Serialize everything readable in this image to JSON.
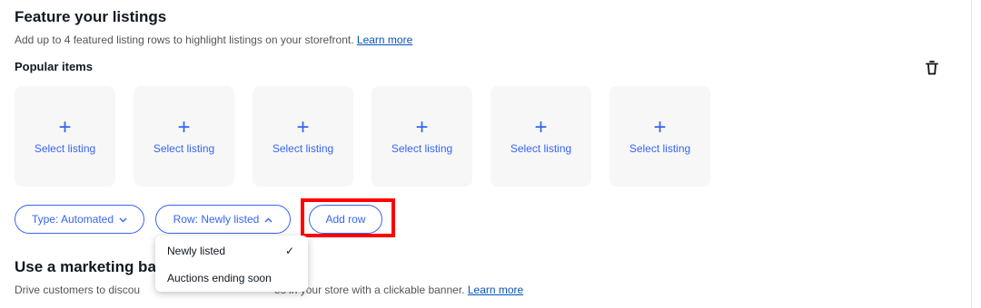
{
  "feature": {
    "title": "Feature your listings",
    "description": "Add up to 4 featured listing rows to highlight listings on your storefront.",
    "learn_more": "Learn more",
    "row_title": "Popular items",
    "tiles": [
      {
        "plus": "+",
        "label": "Select listing"
      },
      {
        "plus": "+",
        "label": "Select listing"
      },
      {
        "plus": "+",
        "label": "Select listing"
      },
      {
        "plus": "+",
        "label": "Select listing"
      },
      {
        "plus": "+",
        "label": "Select listing"
      },
      {
        "plus": "+",
        "label": "Select listing"
      }
    ],
    "type_button": "Type: Automated",
    "row_button": "Row: Newly listed",
    "add_row": "Add row"
  },
  "dropdown": {
    "options": [
      "Newly listed",
      "Auctions ending soon"
    ],
    "selected": "Newly listed",
    "check": "✓"
  },
  "banner": {
    "title": "Use a marketing ba",
    "description_before": "Drive customers to discou",
    "description_after": "es in your store with a clickable banner.",
    "learn_more": "Learn more"
  },
  "icons": {
    "trash": "trash-icon",
    "chevron_down": "chevron-down-icon",
    "chevron_up": "chevron-up-icon",
    "check": "check-icon"
  },
  "colors": {
    "accent": "#3665f3",
    "link": "#0654ba",
    "highlight": "#ff0000",
    "tile_bg": "#f7f7f7"
  }
}
